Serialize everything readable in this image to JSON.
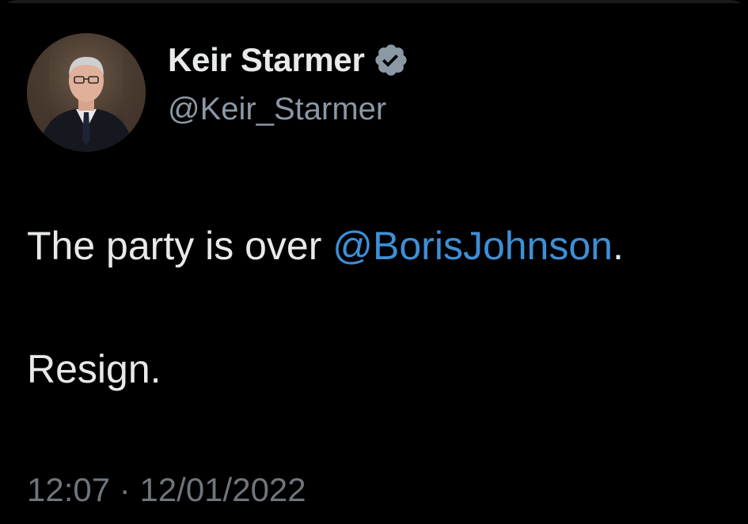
{
  "author": {
    "display_name": "Keir Starmer",
    "handle": "@Keir_Starmer",
    "verified_icon": "verified-badge-icon",
    "avatar": "profile-photo"
  },
  "tweet": {
    "text_before_mention": "The party is over ",
    "mention": "@BorisJohnson",
    "text_after_mention": ".",
    "second_paragraph": "Resign."
  },
  "meta": {
    "time": "12:07",
    "separator": " · ",
    "date": "12/01/2022"
  },
  "colors": {
    "background": "#000000",
    "text": "#e7e9ea",
    "handle": "#8b98a5",
    "mention": "#3e8fd6",
    "meta": "#6e767d",
    "verified_badge": "#8b98a5"
  }
}
